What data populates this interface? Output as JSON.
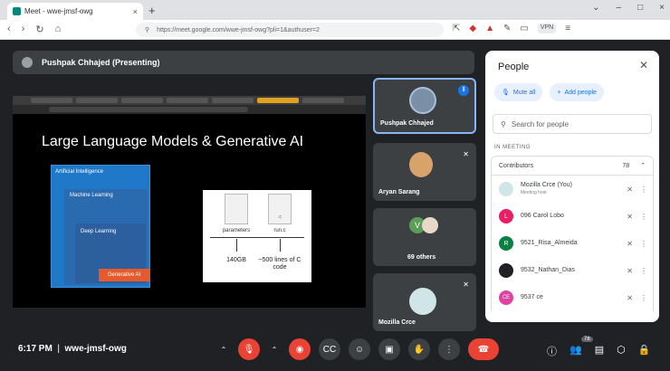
{
  "browser": {
    "tab_title": "Meet - wwe-jmsf-owg",
    "tab_close": "×",
    "new_tab": "+",
    "window_controls": [
      "⌄",
      "–",
      "□",
      "×"
    ],
    "nav": [
      "‹",
      "›",
      "↻",
      "⌂"
    ],
    "url": "https://meet.google.com/wwe-jmsf-owg?pli=1&authuser=2",
    "vpn_label": "VPN"
  },
  "meet": {
    "presenter_bar": "Pushpak Chhajed (Presenting)",
    "slide": {
      "title": "Large Language Models & Generative AI",
      "ai_label": "Artificial Intelligence",
      "ml_label": "Machine Learning",
      "dl_label": "Deep Learning",
      "gen_label": "Generative AI",
      "file1_ext": "",
      "file2_ext": ".c",
      "file1_label": "parameters",
      "file2_label": "run.c",
      "size1": "140GB",
      "size2": "~500 lines of C code"
    },
    "tiles": [
      {
        "name": "Pushpak Chhajed"
      },
      {
        "name": "Aryan Sarang"
      },
      {
        "name": "69 others",
        "avatar_letter": "V"
      },
      {
        "name": "Mozilla Crce"
      }
    ],
    "clock": "6:17 PM",
    "meeting_code": "wwe-jmsf-owg",
    "participants_badge": "78"
  },
  "people": {
    "title": "People",
    "mute_all": "Mute all",
    "add_people": "Add people",
    "search_placeholder": "Search for people",
    "section": "IN MEETING",
    "contributors": "Contributors",
    "contributors_count": "78",
    "rows": [
      {
        "name": "Mozilla Crce (You)",
        "sub": "Meeting host",
        "letter": "",
        "color": "#cfe5e8"
      },
      {
        "name": "096 Carol Lobo",
        "sub": "",
        "letter": "L",
        "color": "#e91e63"
      },
      {
        "name": "9521_Risa_Almeida",
        "sub": "",
        "letter": "R",
        "color": "#0b8043"
      },
      {
        "name": "9532_Nathan_Dias",
        "sub": "",
        "letter": "",
        "color": "#202124"
      },
      {
        "name": "9537 ce",
        "sub": "",
        "letter": "CE",
        "color": "#e040a0"
      }
    ]
  }
}
